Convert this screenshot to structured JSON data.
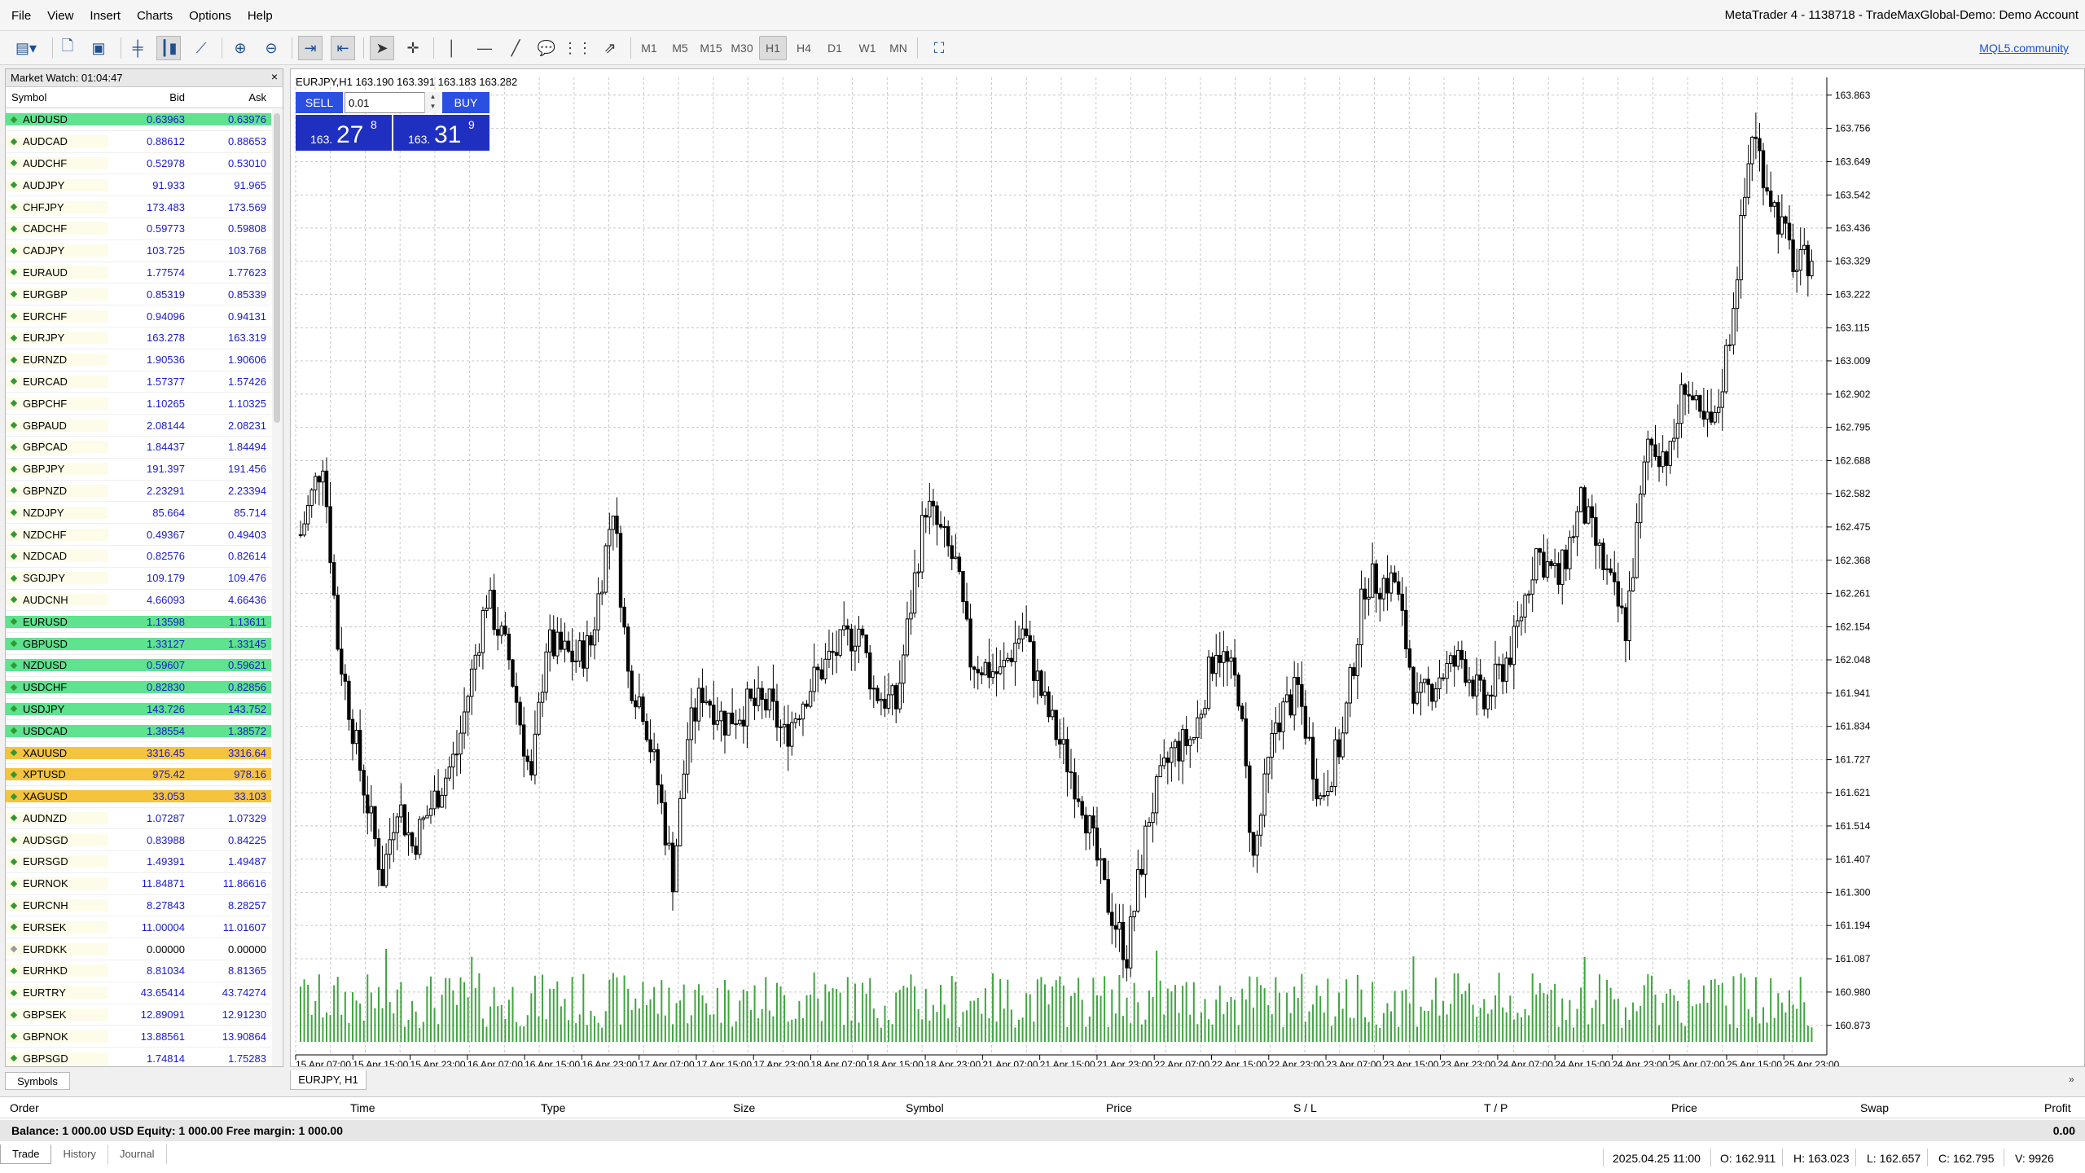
{
  "menu": [
    "File",
    "View",
    "Insert",
    "Charts",
    "Options",
    "Help"
  ],
  "window_title": "MetaTrader 4 - 1138718 - TradeMaxGlobal-Demo: Demo Account",
  "mql5_link": "MQL5.community",
  "timeframes": [
    "M1",
    "M5",
    "M15",
    "M30",
    "H1",
    "H4",
    "D1",
    "W1",
    "MN"
  ],
  "active_timeframe": "H1",
  "market_watch": {
    "title": "Market Watch: 01:04:47",
    "close": "×",
    "col_symbol": "Symbol",
    "col_bid": "Bid",
    "col_ask": "Ask",
    "rows": [
      {
        "s": "AUDUSD",
        "b": "0.63963",
        "a": "0.63976",
        "hl": "green"
      },
      {
        "s": "AUDCAD",
        "b": "0.88612",
        "a": "0.88653",
        "hl": ""
      },
      {
        "s": "AUDCHF",
        "b": "0.52978",
        "a": "0.53010",
        "hl": ""
      },
      {
        "s": "AUDJPY",
        "b": "91.933",
        "a": "91.965",
        "hl": ""
      },
      {
        "s": "CHFJPY",
        "b": "173.483",
        "a": "173.569",
        "hl": ""
      },
      {
        "s": "CADCHF",
        "b": "0.59773",
        "a": "0.59808",
        "hl": ""
      },
      {
        "s": "CADJPY",
        "b": "103.725",
        "a": "103.768",
        "hl": ""
      },
      {
        "s": "EURAUD",
        "b": "1.77574",
        "a": "1.77623",
        "hl": ""
      },
      {
        "s": "EURGBP",
        "b": "0.85319",
        "a": "0.85339",
        "hl": ""
      },
      {
        "s": "EURCHF",
        "b": "0.94096",
        "a": "0.94131",
        "hl": ""
      },
      {
        "s": "EURJPY",
        "b": "163.278",
        "a": "163.319",
        "hl": ""
      },
      {
        "s": "EURNZD",
        "b": "1.90536",
        "a": "1.90606",
        "hl": ""
      },
      {
        "s": "EURCAD",
        "b": "1.57377",
        "a": "1.57426",
        "hl": ""
      },
      {
        "s": "GBPCHF",
        "b": "1.10265",
        "a": "1.10325",
        "hl": ""
      },
      {
        "s": "GBPAUD",
        "b": "2.08144",
        "a": "2.08231",
        "hl": ""
      },
      {
        "s": "GBPCAD",
        "b": "1.84437",
        "a": "1.84494",
        "hl": ""
      },
      {
        "s": "GBPJPY",
        "b": "191.397",
        "a": "191.456",
        "hl": ""
      },
      {
        "s": "GBPNZD",
        "b": "2.23291",
        "a": "2.23394",
        "hl": ""
      },
      {
        "s": "NZDJPY",
        "b": "85.664",
        "a": "85.714",
        "hl": ""
      },
      {
        "s": "NZDCHF",
        "b": "0.49367",
        "a": "0.49403",
        "hl": ""
      },
      {
        "s": "NZDCAD",
        "b": "0.82576",
        "a": "0.82614",
        "hl": ""
      },
      {
        "s": "SGDJPY",
        "b": "109.179",
        "a": "109.476",
        "hl": ""
      },
      {
        "s": "AUDCNH",
        "b": "4.66093",
        "a": "4.66436",
        "hl": ""
      },
      {
        "s": "EURUSD",
        "b": "1.13598",
        "a": "1.13611",
        "hl": "green"
      },
      {
        "s": "GBPUSD",
        "b": "1.33127",
        "a": "1.33145",
        "hl": "green"
      },
      {
        "s": "NZDUSD",
        "b": "0.59607",
        "a": "0.59621",
        "hl": "green"
      },
      {
        "s": "USDCHF",
        "b": "0.82830",
        "a": "0.82856",
        "hl": "green"
      },
      {
        "s": "USDJPY",
        "b": "143.726",
        "a": "143.752",
        "hl": "green"
      },
      {
        "s": "USDCAD",
        "b": "1.38554",
        "a": "1.38572",
        "hl": "green"
      },
      {
        "s": "XAUUSD",
        "b": "3316.45",
        "a": "3316.64",
        "hl": "gold"
      },
      {
        "s": "XPTUSD",
        "b": "975.42",
        "a": "978.16",
        "hl": "gold"
      },
      {
        "s": "XAGUSD",
        "b": "33.053",
        "a": "33.103",
        "hl": "gold"
      },
      {
        "s": "AUDNZD",
        "b": "1.07287",
        "a": "1.07329",
        "hl": ""
      },
      {
        "s": "AUDSGD",
        "b": "0.83988",
        "a": "0.84225",
        "hl": ""
      },
      {
        "s": "EURSGD",
        "b": "1.49391",
        "a": "1.49487",
        "hl": ""
      },
      {
        "s": "EURNOK",
        "b": "11.84871",
        "a": "11.86616",
        "hl": ""
      },
      {
        "s": "EURCNH",
        "b": "8.27843",
        "a": "8.28257",
        "hl": ""
      },
      {
        "s": "EURSEK",
        "b": "11.00004",
        "a": "11.01607",
        "hl": ""
      },
      {
        "s": "EURDKK",
        "b": "0.00000",
        "a": "0.00000",
        "hl": "zero"
      },
      {
        "s": "EURHKD",
        "b": "8.81034",
        "a": "8.81365",
        "hl": ""
      },
      {
        "s": "EURTRY",
        "b": "43.65414",
        "a": "43.74274",
        "hl": ""
      },
      {
        "s": "GBPSEK",
        "b": "12.89091",
        "a": "12.91230",
        "hl": ""
      },
      {
        "s": "GBPNOK",
        "b": "13.88561",
        "a": "13.90864",
        "hl": ""
      },
      {
        "s": "GBPSGD",
        "b": "1.74814",
        "a": "1.75283",
        "hl": ""
      }
    ],
    "tab": "Symbols"
  },
  "chart": {
    "info": "EURJPY,H1  163.190 163.391 163.183 163.282",
    "tab": "EURJPY, H1",
    "trade": {
      "sell": "SELL",
      "buy": "BUY",
      "lot": "0.01",
      "sell_pre": "163.",
      "sell_big": "27",
      "sell_sup": "8",
      "buy_pre": "163.",
      "buy_big": "31",
      "buy_sup": "9"
    }
  },
  "chart_data": {
    "type": "candlestick",
    "symbol": "EURJPY",
    "timeframe": "H1",
    "y_ticks": [
      "163.863",
      "163.756",
      "163.649",
      "163.542",
      "163.436",
      "163.329",
      "163.222",
      "163.115",
      "163.009",
      "162.902",
      "162.795",
      "162.688",
      "162.582",
      "162.475",
      "162.368",
      "162.261",
      "162.154",
      "162.048",
      "161.941",
      "161.834",
      "161.727",
      "161.621",
      "161.514",
      "161.407",
      "161.300",
      "161.194",
      "161.087",
      "160.980",
      "160.873"
    ],
    "x_ticks": [
      "15 Apr 07:00",
      "15 Apr 15:00",
      "15 Apr 23:00",
      "16 Apr 07:00",
      "16 Apr 15:00",
      "16 Apr 23:00",
      "17 Apr 07:00",
      "17 Apr 15:00",
      "17 Apr 23:00",
      "18 Apr 07:00",
      "18 Apr 15:00",
      "18 Apr 23:00",
      "21 Apr 07:00",
      "21 Apr 15:00",
      "21 Apr 23:00",
      "22 Apr 07:00",
      "22 Apr 15:00",
      "22 Apr 23:00",
      "23 Apr 07:00",
      "23 Apr 15:00",
      "23 Apr 23:00",
      "24 Apr 07:00",
      "24 Apr 15:00",
      "24 Apr 23:00",
      "25 Apr 07:00",
      "25 Apr 15:00",
      "25 Apr 23:00"
    ],
    "ylim": [
      160.82,
      163.92
    ],
    "grid": true,
    "volume_color": "#3fa53f",
    "close_path": [
      [
        0,
        162.45
      ],
      [
        6,
        162.7
      ],
      [
        10,
        162.1
      ],
      [
        16,
        161.7
      ],
      [
        22,
        161.35
      ],
      [
        26,
        161.6
      ],
      [
        30,
        161.45
      ],
      [
        36,
        161.6
      ],
      [
        42,
        161.75
      ],
      [
        50,
        162.25
      ],
      [
        56,
        162.05
      ],
      [
        62,
        161.65
      ],
      [
        66,
        162.1
      ],
      [
        74,
        162.05
      ],
      [
        78,
        162.1
      ],
      [
        84,
        162.55
      ],
      [
        88,
        162.0
      ],
      [
        92,
        161.9
      ],
      [
        96,
        161.65
      ],
      [
        100,
        161.35
      ],
      [
        104,
        161.8
      ],
      [
        108,
        161.95
      ],
      [
        114,
        161.85
      ],
      [
        120,
        161.9
      ],
      [
        126,
        161.9
      ],
      [
        130,
        161.8
      ],
      [
        136,
        161.95
      ],
      [
        142,
        162.05
      ],
      [
        150,
        162.15
      ],
      [
        154,
        161.95
      ],
      [
        160,
        161.9
      ],
      [
        168,
        162.55
      ],
      [
        176,
        162.35
      ],
      [
        180,
        162.05
      ],
      [
        188,
        162.0
      ],
      [
        194,
        162.15
      ],
      [
        200,
        161.9
      ],
      [
        210,
        161.6
      ],
      [
        216,
        161.3
      ],
      [
        222,
        161.1
      ],
      [
        228,
        161.55
      ],
      [
        234,
        161.75
      ],
      [
        240,
        161.8
      ],
      [
        246,
        162.1
      ],
      [
        252,
        161.95
      ],
      [
        256,
        161.4
      ],
      [
        262,
        161.85
      ],
      [
        268,
        161.95
      ],
      [
        274,
        161.6
      ],
      [
        280,
        161.8
      ],
      [
        286,
        162.3
      ],
      [
        294,
        162.3
      ],
      [
        300,
        161.9
      ],
      [
        306,
        162.0
      ],
      [
        312,
        162.05
      ],
      [
        318,
        161.9
      ],
      [
        326,
        162.1
      ],
      [
        332,
        162.4
      ],
      [
        338,
        162.3
      ],
      [
        344,
        162.55
      ],
      [
        350,
        162.35
      ],
      [
        356,
        162.15
      ],
      [
        362,
        162.75
      ],
      [
        368,
        162.7
      ],
      [
        372,
        162.95
      ],
      [
        376,
        162.8
      ],
      [
        380,
        162.8
      ],
      [
        384,
        163.1
      ],
      [
        390,
        163.75
      ],
      [
        396,
        163.5
      ],
      [
        402,
        163.3
      ],
      [
        406,
        163.35
      ]
    ],
    "volume_range": [
      0.15,
      1.0
    ]
  },
  "terminal": {
    "cols": [
      "Order",
      "Time",
      "Type",
      "Size",
      "Symbol",
      "Price",
      "S / L",
      "T / P",
      "Price",
      "Swap",
      "Profit"
    ],
    "balance": "Balance: 1 000.00 USD   Equity: 1 000.00   Free margin: 1 000.00",
    "total": "0.00",
    "tabs": [
      "Trade",
      "History",
      "Journal"
    ]
  },
  "status": {
    "time": "2025.04.25 11:00",
    "open": "O: 162.911",
    "high": "H: 163.023",
    "low": "L: 162.657",
    "close": "C: 162.795",
    "vol": "V: 9926"
  }
}
